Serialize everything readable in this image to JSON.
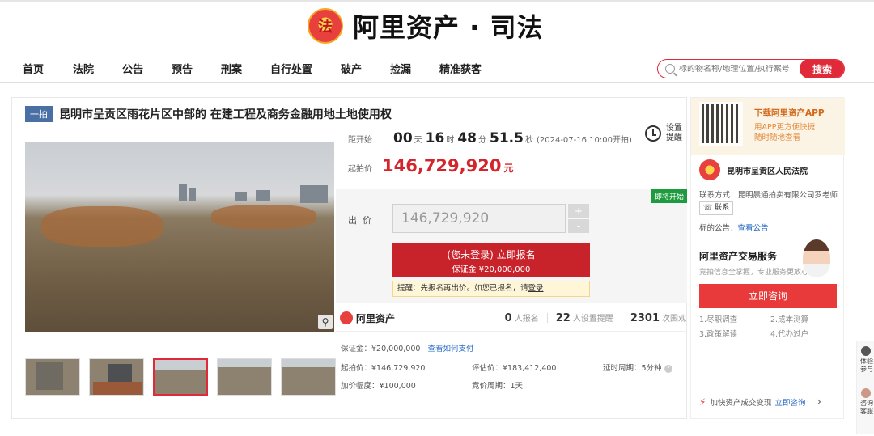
{
  "brand": {
    "emblem": "法",
    "name": "阿里资产 · 司法"
  },
  "nav": {
    "items": [
      "首页",
      "法院",
      "公告",
      "预告",
      "刑案",
      "自行处置",
      "破产",
      "捡漏",
      "精准获客"
    ]
  },
  "search": {
    "placeholder": "标的物名称/地理位置/执行案号",
    "button": "搜索"
  },
  "listing": {
    "tag": "一拍",
    "title": "昆明市呈贡区雨花片区中部的 在建工程及商务金融用地土地使用权",
    "countdown_label": "距开始",
    "countdown": {
      "d": "00",
      "d_unit": "天",
      "h": "16",
      "h_unit": "时",
      "m": "48",
      "m_unit": "分",
      "s": "51.5",
      "s_unit": "秒"
    },
    "start_time": "(2024-07-16 10:00开拍)",
    "remind": "设置\n提醒",
    "start_price_label": "起拍价",
    "start_price": "146,729,920",
    "price_unit": "元",
    "soon_badge": "即将开始",
    "bid_label": "出  价",
    "bid_value": "146,729,920",
    "stepper_plus": "+",
    "stepper_minus": "-",
    "register_line1": "(您未登录) 立即报名",
    "register_line2": "保证金 ¥20,000,000",
    "tip_text": "提醒：先报名再出价。如您已报名，请",
    "tip_link": "登录",
    "zoom_icon": "magnifier-icon"
  },
  "stats": {
    "ali_name": "阿里资产",
    "signups": "0",
    "signups_label": "人报名",
    "reminders": "22",
    "reminders_label": "人设置提醒",
    "views": "2301",
    "views_label": "次围观"
  },
  "details": {
    "deposit": "保证金：¥20,000,000",
    "pay_link": "查看如何支付",
    "start_price": "起拍价：¥146,729,920",
    "appraisal": "评估价：¥183,412,400",
    "delay": "延时周期：5分钟",
    "increment": "加价幅度：¥100,000",
    "auction_period": "竞价周期：1天"
  },
  "side": {
    "app_title": "下载阿里资产APP",
    "app_sub1": "用APP更方便快捷",
    "app_sub2": "随时随地查看",
    "court_name": "昆明市呈贡区人民法院",
    "contact": "联系方式：昆明晨通拍卖有限公司罗老师",
    "contact_btn": "联系",
    "notice_label": "标的公告：",
    "notice_link": "查看公告",
    "svc_title": "阿里资产交易服务",
    "svc_sub": "竞拍信息全掌握，专业服务更放心",
    "consult": "立即咨询",
    "svc_items": [
      "1.尽职调查",
      "2.成本测算",
      "3.政策解读",
      "4.代办过户"
    ],
    "fast_text": "加快资产成交变现",
    "fast_link": "立即咨询",
    "fast_arrow": "›"
  },
  "float": {
    "t1": "体验",
    "t2": "参与",
    "t3": "咨询",
    "t4": "客服"
  },
  "colors": {
    "accent": "#e02a3a",
    "price": "#d4252c",
    "badge": "#1e9b3f",
    "link": "#2b6cc4"
  }
}
